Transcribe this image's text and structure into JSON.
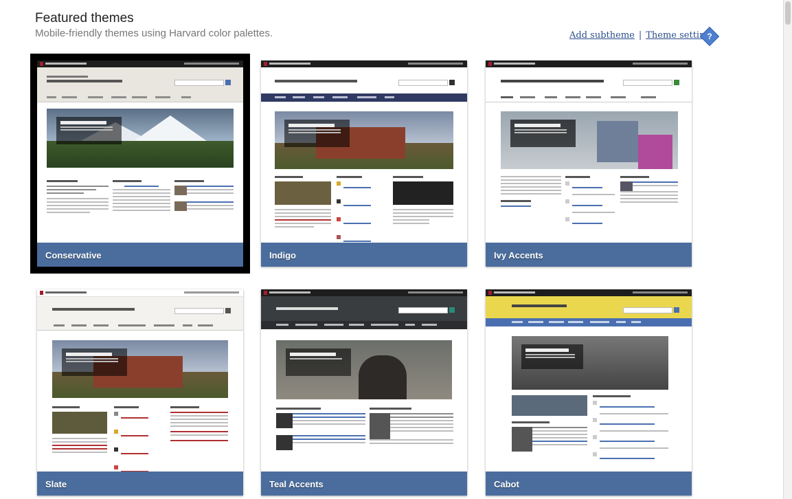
{
  "header": {
    "title": "Featured themes",
    "subtitle": "Mobile-friendly themes using Harvard color palettes.",
    "add_subtheme": "Add subtheme",
    "separator": "|",
    "theme_settings": "Theme settings",
    "help_icon": "?"
  },
  "themes": [
    {
      "label": "Conservative",
      "selected": true
    },
    {
      "label": "Indigo",
      "selected": false
    },
    {
      "label": "Ivy Accents",
      "selected": false
    },
    {
      "label": "Slate",
      "selected": false
    },
    {
      "label": "Teal Accents",
      "selected": false
    },
    {
      "label": "Cabot",
      "selected": false
    }
  ],
  "colors": {
    "caption_bg": "#4a6d9e",
    "selected_outline": "#000000",
    "link": "#2a4d8b"
  }
}
